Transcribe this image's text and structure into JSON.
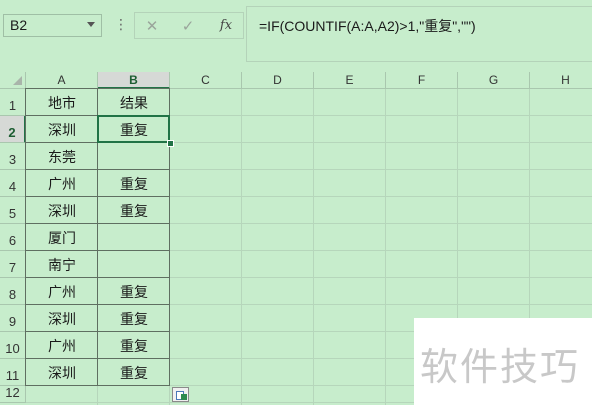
{
  "formula_bar": {
    "name_box": "B2",
    "more_glyph": "⋮",
    "cancel_glyph": "✕",
    "enter_glyph": "✓",
    "fx_label": "fx",
    "formula": "=IF(COUNTIF(A:A,A2)>1,\"重复\",\"\")"
  },
  "columns": [
    "A",
    "B",
    "C",
    "D",
    "E",
    "F",
    "G",
    "H"
  ],
  "selected_column": "B",
  "rows": [
    "1",
    "2",
    "3",
    "4",
    "5",
    "6",
    "7",
    "8",
    "9",
    "10",
    "11",
    "12"
  ],
  "selected_row": "2",
  "active_cell": "B2",
  "table": [
    [
      "地市",
      "结果"
    ],
    [
      "深圳",
      "重复"
    ],
    [
      "东莞",
      ""
    ],
    [
      "广州",
      "重复"
    ],
    [
      "深圳",
      "重复"
    ],
    [
      "厦门",
      ""
    ],
    [
      "南宁",
      ""
    ],
    [
      "广州",
      "重复"
    ],
    [
      "深圳",
      "重复"
    ],
    [
      "广州",
      "重复"
    ],
    [
      "深圳",
      "重复"
    ]
  ],
  "watermark": "软件技巧",
  "colors": {
    "background": "#c7edcc",
    "selection": "#217346",
    "header_selected": "#d6d9d6"
  }
}
